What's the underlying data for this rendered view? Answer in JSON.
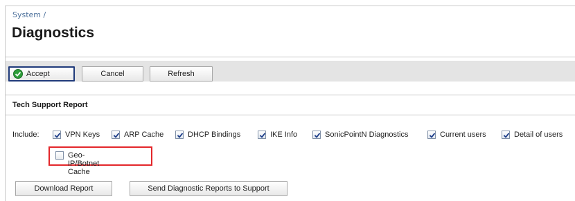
{
  "breadcrumb": "System /",
  "page_title": "Diagnostics",
  "toolbar": {
    "accept_label": "Accept",
    "cancel_label": "Cancel",
    "refresh_label": "Refresh"
  },
  "tech_support": {
    "section_title": "Tech Support Report",
    "include_label": "Include:",
    "options": [
      {
        "label": "VPN Keys",
        "checked": true
      },
      {
        "label": "ARP Cache",
        "checked": true
      },
      {
        "label": "DHCP Bindings",
        "checked": true
      },
      {
        "label": "IKE Info",
        "checked": true
      },
      {
        "label": "SonicPointN Diagnostics",
        "checked": true
      },
      {
        "label": "Current users",
        "checked": true
      },
      {
        "label": "Detail of users",
        "checked": true
      }
    ],
    "geo_option": {
      "label": "Geo-IP/Botnet Cache",
      "checked": false
    },
    "download_label": "Download Report",
    "send_label": "Send Diagnostic Reports to Support"
  },
  "colors": {
    "highlight": "#e3262a",
    "toolbar_bg": "#e4e4e4",
    "accept_icon": "#2e9e3a",
    "breadcrumb": "#4a6e9a"
  }
}
